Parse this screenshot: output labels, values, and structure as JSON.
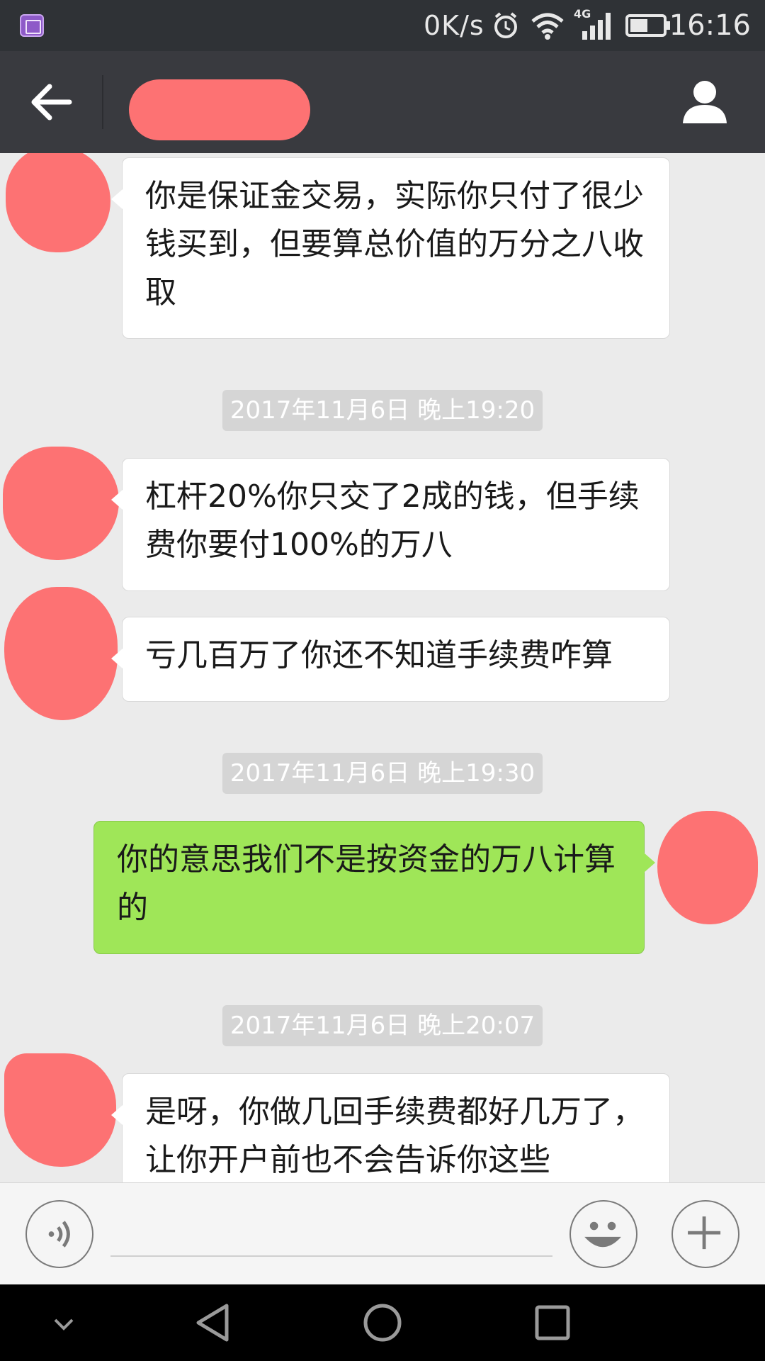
{
  "status_bar": {
    "net_speed": "0K/s",
    "network_type": "4G",
    "time": "16:16",
    "icons": [
      "gallery-icon",
      "alarm-icon",
      "wifi-icon",
      "signal-icon",
      "battery-icon"
    ]
  },
  "app_bar": {
    "icons": [
      "back-arrow-icon",
      "profile-icon"
    ],
    "title_redacted": true,
    "redaction_color": "#fd7273"
  },
  "chat": {
    "messages": [
      {
        "side": "left",
        "text": "你是保证金交易，实际你只付了很少钱买到，但要算总价值的万分之八收取"
      },
      {
        "type": "timestamp",
        "text": "2017年11月6日 晚上19:20"
      },
      {
        "side": "left",
        "text": "杠杆20%你只交了2成的钱，但手续费你要付100%的万八"
      },
      {
        "side": "left",
        "text": "亏几百万了你还不知道手续费咋算"
      },
      {
        "type": "timestamp",
        "text": "2017年11月6日 晚上19:30"
      },
      {
        "side": "right",
        "text": "你的意思我们不是按资金的万八计算的"
      },
      {
        "type": "timestamp",
        "text": "2017年11月6日 晚上20:07"
      },
      {
        "side": "left",
        "text": "是呀，你做几回手续费都好几万了，让你开户前也不会告诉你这些"
      }
    ],
    "colors": {
      "incoming_bubble": "#ffffff",
      "outgoing_bubble": "#9fe658",
      "background": "#ebebeb"
    }
  },
  "input_bar": {
    "icons": [
      "voice-icon",
      "emoji-icon",
      "plus-icon"
    ],
    "input_value": ""
  },
  "nav_bar": {
    "icons": [
      "collapse-icon",
      "back-icon",
      "home-icon",
      "recents-icon"
    ]
  }
}
